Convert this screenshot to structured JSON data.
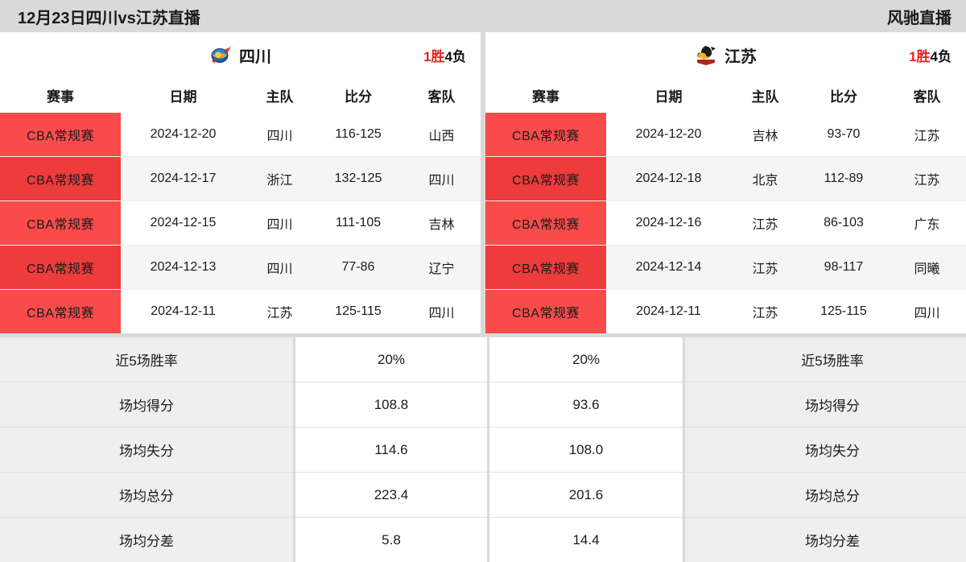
{
  "topbar": {
    "title": "12月23日四川vs江苏直播",
    "brand": "风驰直播"
  },
  "teams": {
    "left": {
      "name": "四川",
      "logo_icon": "sichuan-team-logo-icon",
      "record_win": "1胜",
      "record_loss": "4负"
    },
    "right": {
      "name": "江苏",
      "logo_icon": "jiangsu-team-logo-icon",
      "record_win": "1胜",
      "record_loss": "4负"
    }
  },
  "match_table": {
    "headers": [
      "赛事",
      "日期",
      "主队",
      "比分",
      "客队"
    ],
    "left_rows": [
      {
        "league": "CBA常规赛",
        "date": "2024-12-20",
        "home": "四川",
        "score": "116-125",
        "away": "山西"
      },
      {
        "league": "CBA常规赛",
        "date": "2024-12-17",
        "home": "浙江",
        "score": "132-125",
        "away": "四川"
      },
      {
        "league": "CBA常规赛",
        "date": "2024-12-15",
        "home": "四川",
        "score": "111-105",
        "away": "吉林"
      },
      {
        "league": "CBA常规赛",
        "date": "2024-12-13",
        "home": "四川",
        "score": "77-86",
        "away": "辽宁"
      },
      {
        "league": "CBA常规赛",
        "date": "2024-12-11",
        "home": "江苏",
        "score": "125-115",
        "away": "四川"
      }
    ],
    "right_rows": [
      {
        "league": "CBA常规赛",
        "date": "2024-12-20",
        "home": "吉林",
        "score": "93-70",
        "away": "江苏"
      },
      {
        "league": "CBA常规赛",
        "date": "2024-12-18",
        "home": "北京",
        "score": "112-89",
        "away": "江苏"
      },
      {
        "league": "CBA常规赛",
        "date": "2024-12-16",
        "home": "江苏",
        "score": "86-103",
        "away": "广东"
      },
      {
        "league": "CBA常规赛",
        "date": "2024-12-14",
        "home": "江苏",
        "score": "98-117",
        "away": "同曦"
      },
      {
        "league": "CBA常规赛",
        "date": "2024-12-11",
        "home": "江苏",
        "score": "125-115",
        "away": "四川"
      }
    ]
  },
  "stats": [
    {
      "label_left": "近5场胜率",
      "value_left": "20%",
      "value_right": "20%",
      "label_right": "近5场胜率"
    },
    {
      "label_left": "场均得分",
      "value_left": "108.8",
      "value_right": "93.6",
      "label_right": "场均得分"
    },
    {
      "label_left": "场均失分",
      "value_left": "114.6",
      "value_right": "108.0",
      "label_right": "场均失分"
    },
    {
      "label_left": "场均总分",
      "value_left": "223.4",
      "value_right": "201.6",
      "label_right": "场均总分"
    },
    {
      "label_left": "场均分差",
      "value_left": "5.8",
      "value_right": "14.4",
      "label_right": "场均分差"
    }
  ],
  "colors": {
    "page_background": "#d9d9d9",
    "league_badge_red": "#fa4b4b",
    "league_badge_red_alt": "#ee3b3b",
    "win_red": "#e8201d",
    "stat_label_background": "#efefef"
  }
}
